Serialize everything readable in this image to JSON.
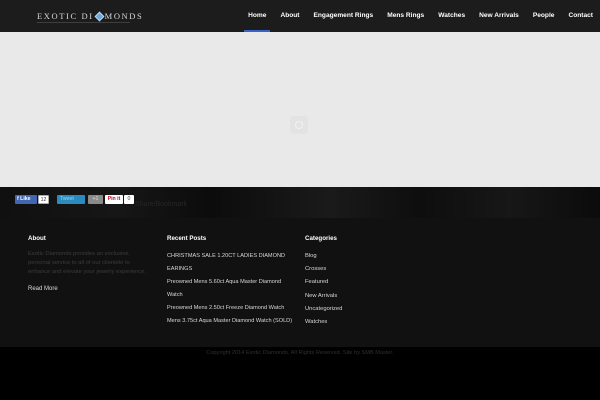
{
  "header": {
    "logo_left": "EXOTIC DI",
    "logo_right": "MONDS",
    "nav": [
      "Home",
      "About",
      "Engagement Rings",
      "Mens Rings",
      "Watches",
      "New Arrivals",
      "People",
      "Contact"
    ],
    "active": "Home",
    "accent": "#3b62c7"
  },
  "share": {
    "facebook_label": "Like",
    "facebook_count": "12",
    "twitter_label": "Tweet",
    "google_label": "+1",
    "pinterest_label": "Pin it",
    "pinterest_count": "0",
    "label": "Share/Bookmark"
  },
  "footer": {
    "about": {
      "heading": "About",
      "text": "Exotic Diamonds provides an exclusive, personal service to all of our clientele to enhance and elevate your jewelry experience.",
      "link": "Read More"
    },
    "recent": {
      "heading": "Recent Posts",
      "posts": [
        "CHRISTMAS SALE 1.20CT LADIES DIAMOND",
        "EARINGS",
        "Preowned Mens 5.60ct Aqua Master Diamond",
        "Watch",
        "Preowned Mens 2.50ct Freeze Diamond Watch",
        "Mens 3.75ct Aqua Master Diamond Watch (SOLD)"
      ]
    },
    "categories": {
      "heading": "Categories",
      "items": [
        "Blog",
        "Crosses",
        "Featured",
        "New Arrivals",
        "Uncategorized",
        "Watches"
      ]
    }
  },
  "copyright": "Copyright 2014 Exotic Diamonds. All Rights Reserved. Site by SMB Master."
}
